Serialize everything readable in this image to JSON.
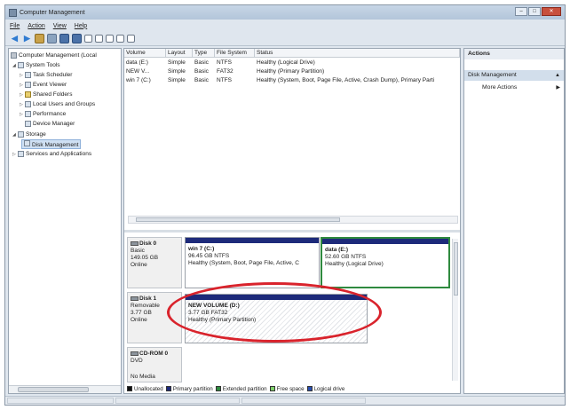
{
  "window": {
    "title": "Computer Management"
  },
  "menu": [
    "File",
    "Action",
    "View",
    "Help"
  ],
  "tree": {
    "root": "Computer Management (Local",
    "system_tools": "System Tools",
    "task_scheduler": "Task Scheduler",
    "event_viewer": "Event Viewer",
    "shared_folders": "Shared Folders",
    "local_users": "Local Users and Groups",
    "performance": "Performance",
    "device_manager": "Device Manager",
    "storage": "Storage",
    "disk_management": "Disk Management",
    "services": "Services and Applications"
  },
  "volume_list": {
    "headers": [
      "Volume",
      "Layout",
      "Type",
      "File System",
      "Status"
    ],
    "rows": [
      {
        "volume": "data (E:)",
        "layout": "Simple",
        "type": "Basic",
        "fs": "NTFS",
        "status": "Healthy (Logical Drive)"
      },
      {
        "volume": "NEW V...",
        "layout": "Simple",
        "type": "Basic",
        "fs": "FAT32",
        "status": "Healthy (Primary Partition)"
      },
      {
        "volume": "win 7 (C:)",
        "layout": "Simple",
        "type": "Basic",
        "fs": "NTFS",
        "status": "Healthy (System, Boot, Page File, Active, Crash Dump), Primary Parti"
      }
    ]
  },
  "disks": {
    "disk0": {
      "name": "Disk 0",
      "type": "Basic",
      "size": "149.05 GB",
      "state": "Online"
    },
    "disk1": {
      "name": "Disk 1",
      "type": "Removable",
      "size": "3.77 GB",
      "state": "Online"
    },
    "cdrom": {
      "name": "CD-ROM 0",
      "type": "DVD",
      "state": "No Media"
    }
  },
  "partitions": {
    "win7": {
      "name": "win 7 (C:)",
      "size": "96.45 GB NTFS",
      "status": "Healthy (System, Boot, Page File, Active, C"
    },
    "data": {
      "name": "data (E:)",
      "size": "52.60 GB NTFS",
      "status": "Healthy (Logical Drive)"
    },
    "newvol": {
      "name": "NEW VOLUME (D:)",
      "size": "3.77 GB FAT32",
      "status": "Healthy (Primary Partition)"
    }
  },
  "legend": {
    "items": [
      {
        "label": "Unallocated",
        "color": "#111111"
      },
      {
        "label": "Primary partition",
        "color": "#1d2a7a"
      },
      {
        "label": "Extended partition",
        "color": "#2f8a3f"
      },
      {
        "label": "Free space",
        "color": "#7fd06a"
      },
      {
        "label": "Logical drive",
        "color": "#2a4fb0"
      }
    ]
  },
  "actions": {
    "header": "Actions",
    "section": "Disk Management",
    "more": "More Actions"
  },
  "colors": {
    "annotation_ring": "#d9232c",
    "primary": "#1d2a7a",
    "selection": "#2f8a3f"
  }
}
